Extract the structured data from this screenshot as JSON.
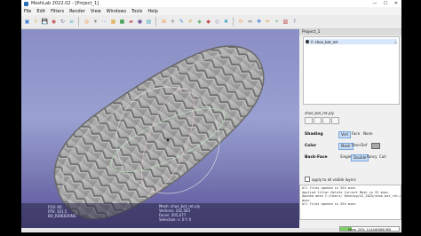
{
  "window": {
    "title": "MeshLab 2022.02 - [Project_1]",
    "controls": [
      "—",
      "☐",
      "✕"
    ]
  },
  "menu": [
    "File",
    "Edit",
    "Filters",
    "Render",
    "View",
    "Windows",
    "Tools",
    "Help"
  ],
  "toolbar_icons": [
    "open-icon",
    "import-icon",
    "save-icon",
    "snapshot-icon",
    "reload-icon",
    "layers-icon",
    "trackball-icon",
    "light-icon",
    "points-icon",
    "wireframe-icon",
    "solid-icon",
    "flat-icon",
    "smooth-icon",
    "texture-icon",
    "measure-icon",
    "pick-icon",
    "annotation-icon",
    "paint-icon",
    "select-vertex-icon",
    "select-face-icon",
    "select-connected-icon",
    "delete-icon",
    "rotate-icon",
    "align-icon",
    "manipulator-icon",
    "sketch-icon",
    "clean-icon",
    "remesh-icon",
    "help-icon"
  ],
  "viewport": {
    "info_left": [
      "FOV: 60",
      "FPS: 101.5",
      "BO_RENDERING"
    ],
    "info_right": [
      "Mesh: shoe_bot_ret.ply",
      "Vertices: 102,563",
      "Faces: 205,077",
      "Selection: v: 0 f: 0"
    ]
  },
  "project": {
    "header": "Project_1",
    "layers": [
      {
        "index": "0",
        "name": "shoe_bot_ret"
      }
    ],
    "selected_mesh": "shoe_bot_ret.ply"
  },
  "render_panel": {
    "shading_label": "Shading",
    "shading_options": [
      "Vert",
      "Face",
      "None"
    ],
    "shading_selected": "Vert",
    "color_label": "Color",
    "color_options": [
      "Mesh",
      "User-Def"
    ],
    "color_selected": "Mesh",
    "backface_label": "Back-Face",
    "backface_options": [
      "Single",
      "Double",
      "Fancy",
      "Cull"
    ],
    "backface_selected": "Double",
    "apply_all_label": "apply to all visible layers"
  },
  "log": [
    "All files opened in 554 msec",
    "Applied filter Delete Current Mesh in 92 msec",
    "Opened mesh C:/Users/ Desktop/LE_2025/shoe_bot_ret.ply in 554",
    "msec",
    "All files opened in 554 msec"
  ],
  "memory": {
    "label": "Mem 20% 1140/6066 MB",
    "used_fraction": 0.2,
    "fill_color": "#7fcf6a"
  },
  "colors": {
    "viewport_top": "#8a8ec4",
    "viewport_bottom": "#5a4f9b",
    "mesh": "#a8a8a8"
  }
}
